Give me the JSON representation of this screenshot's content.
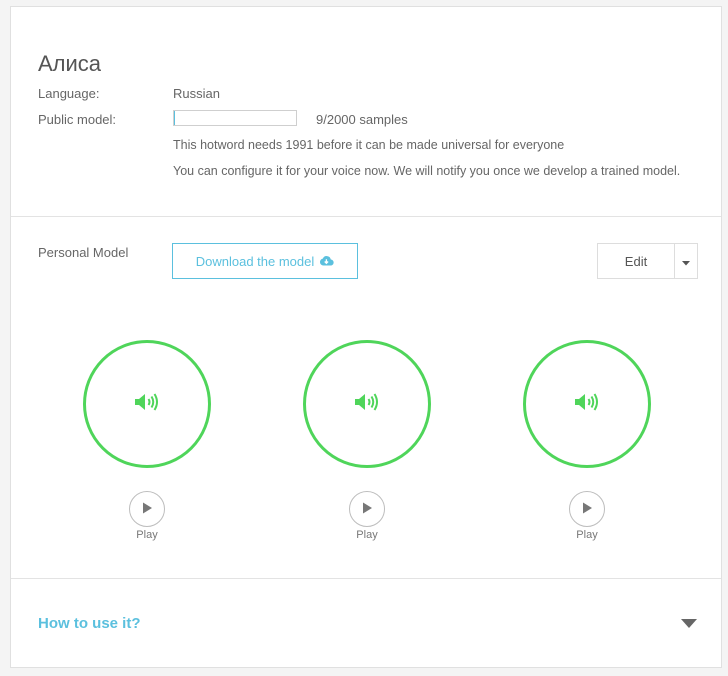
{
  "hotword": {
    "title": "Алиса",
    "language_label": "Language:",
    "language_value": "Russian",
    "public_model_label": "Public model:",
    "samples_collected": 9,
    "samples_required": 2000,
    "samples_text": "9/2000 samples",
    "note_needs": "This hotword needs 1991 before it can be made universal for everyone",
    "note_configure": "You can configure it for your voice now. We will notify you once we develop a trained model."
  },
  "personal_model": {
    "label": "Personal Model",
    "download_label": "Download the model",
    "download_icon": "cloud-download-icon",
    "edit_label": "Edit",
    "edit_caret_icon": "caret-down-icon"
  },
  "samples": [
    {
      "icon": "volume-icon",
      "play_label": "Play"
    },
    {
      "icon": "volume-icon",
      "play_label": "Play"
    },
    {
      "icon": "volume-icon",
      "play_label": "Play"
    }
  ],
  "footer": {
    "how_to_label": "How to use it?",
    "expand_icon": "triangle-down-icon"
  },
  "colors": {
    "accent": "#5bc0de",
    "sample_ring": "#4fd55a",
    "text": "#666666"
  }
}
